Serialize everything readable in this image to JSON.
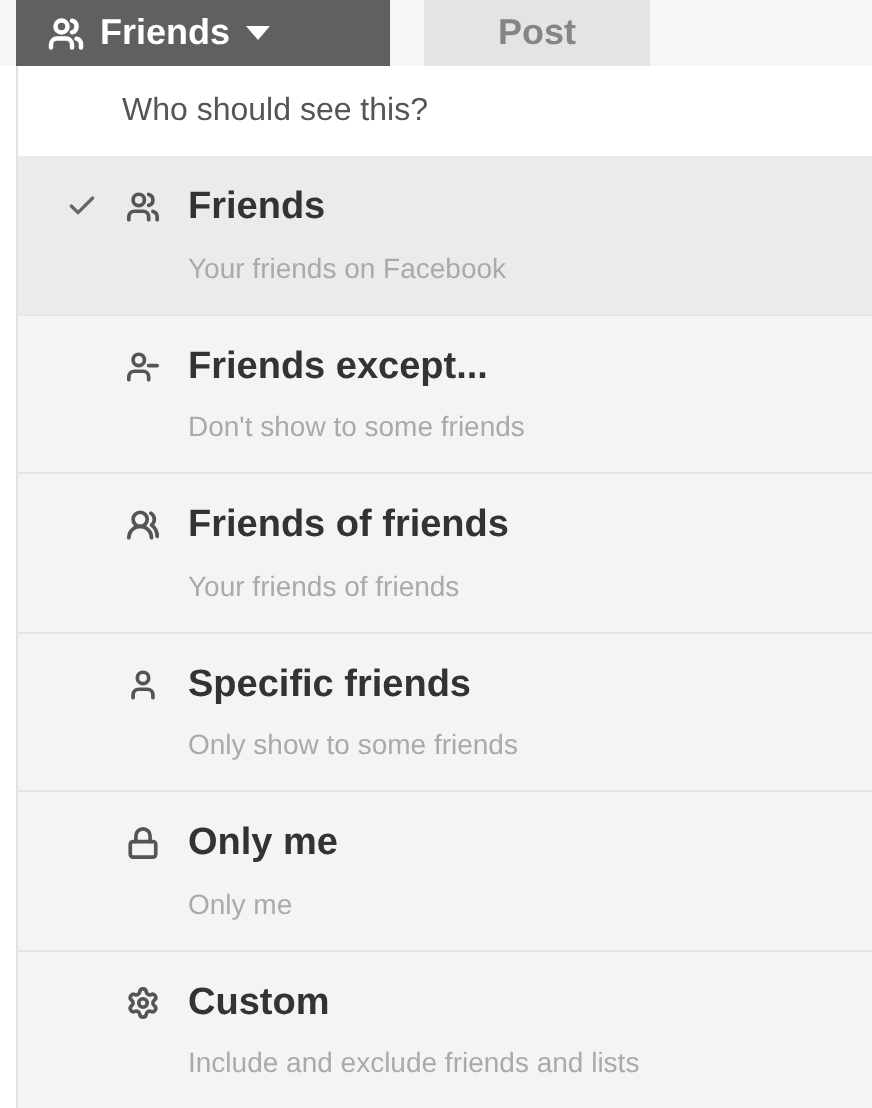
{
  "toolbar": {
    "audience_button": {
      "label": "Friends"
    },
    "post_button": {
      "label": "Post",
      "disabled": true
    }
  },
  "menu": {
    "header": "Who should see this?",
    "items": [
      {
        "kind": "friends",
        "title": "Friends",
        "subtitle": "Your friends on Facebook",
        "selected": true
      },
      {
        "kind": "friends-except",
        "title": "Friends except...",
        "subtitle": "Don't show to some friends",
        "selected": false
      },
      {
        "kind": "friends-of-friends",
        "title": "Friends of friends",
        "subtitle": "Your friends of friends",
        "selected": false
      },
      {
        "kind": "specific",
        "title": "Specific friends",
        "subtitle": "Only show to some friends",
        "selected": false
      },
      {
        "kind": "only-me",
        "title": "Only me",
        "subtitle": "Only me",
        "selected": false
      },
      {
        "kind": "custom",
        "title": "Custom",
        "subtitle": "Include and exclude friends and lists",
        "selected": false
      }
    ]
  }
}
